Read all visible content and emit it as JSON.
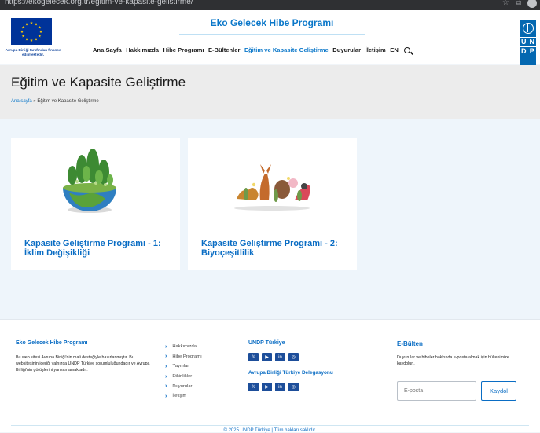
{
  "browser": {
    "url": "https://ekogelecek.org.tr/egitim-ve-kapasite-gelistirme/"
  },
  "header": {
    "eu_caption": "Avrupa Birliği tarafından finanse edilmektedir.",
    "site_title": "Eko Gelecek Hibe Programı",
    "nav": [
      {
        "label": "Ana Sayfa"
      },
      {
        "label": "Hakkımızda"
      },
      {
        "label": "Hibe Programı"
      },
      {
        "label": "E-Bültenler"
      },
      {
        "label": "Eğitim ve Kapasite Geliştirme",
        "active": true
      },
      {
        "label": "Duyurular"
      },
      {
        "label": "İletişim"
      },
      {
        "label": "EN"
      }
    ],
    "undp_letters": [
      "U",
      "N",
      "D",
      "P"
    ]
  },
  "hero": {
    "title": "Eğitim ve Kapasite Geliştirme",
    "breadcrumb_home": "Ana sayfa",
    "breadcrumb_sep": " » ",
    "breadcrumb_current": "Eğitim ve Kapasite Geliştirme"
  },
  "cards": [
    {
      "title": "Kapasite Geliştirme Programı - 1: İklim Değişikliği",
      "image": "earth-forest-illustration"
    },
    {
      "title": "Kapasite Geliştirme Programı - 2: Biyoçeşitlilik",
      "image": "wildlife-illustration"
    }
  ],
  "footer": {
    "about_title": "Eko Gelecek Hibe Programı",
    "about_text": "Bu web sitesi Avrupa Birliği'nin mali desteğiyle hazırlanmıştır. Bu websitesinin içeriği yalnızca UNDP Türkiye sorumluluğundadır ve Avrupa Birliği'nin görüşlerini yansıtmamaktadır.",
    "links": [
      "Hakkımızda",
      "Hibe Programı",
      "Yayınlar",
      "Etkinlikler",
      "Duyurular",
      "İletişim"
    ],
    "undp_title": "UNDP Türkiye",
    "eu_delegation_title": "Avrupa Birliği Türkiye Delegasyonu",
    "social_icons": [
      "x-icon",
      "youtube-icon",
      "linkedin-icon",
      "instagram-icon"
    ],
    "newsletter_title": "E-Bülten",
    "newsletter_text": "Duyurular ve hibeler hakkında e-posta almak için bültenimize kaydolun.",
    "email_placeholder": "E-posta",
    "subscribe_label": "Kaydol",
    "copyright": "© 2025 UNDP Türkiye | Tüm hakları saklıdır."
  },
  "colors": {
    "brand_blue": "#0a77c9",
    "undp_blue": "#0468b1",
    "eu_blue": "#003399"
  }
}
